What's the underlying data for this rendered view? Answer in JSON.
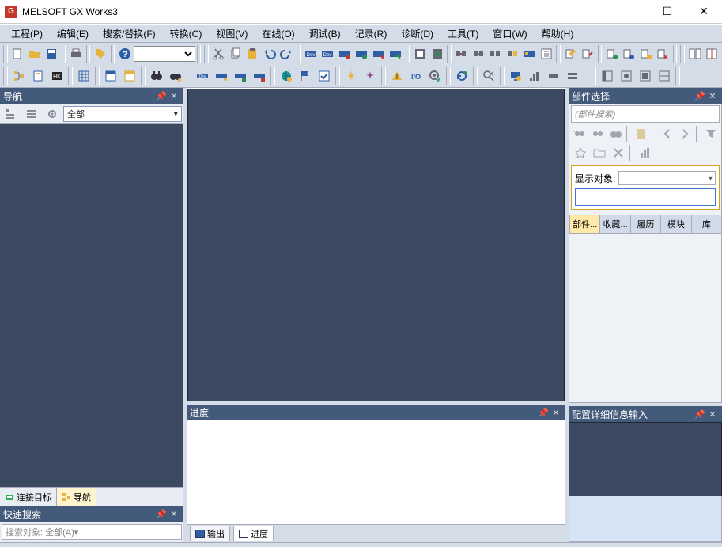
{
  "title": "MELSOFT GX Works3",
  "window": {
    "min": "—",
    "max": "☐",
    "close": "✕"
  },
  "menu": [
    "工程(P)",
    "编辑(E)",
    "搜索/替换(F)",
    "转换(C)",
    "视图(V)",
    "在线(O)",
    "调试(B)",
    "记录(R)",
    "诊断(D)",
    "工具(T)",
    "窗口(W)",
    "帮助(H)"
  ],
  "nav": {
    "title": "导航",
    "filter_label": "全部",
    "tabs": {
      "conn": "连接目标",
      "nav": "导航"
    }
  },
  "quick_search": {
    "title": "快速搜索",
    "placeholder": "搜索对象: 全部(A)▾"
  },
  "progress": {
    "title": "进度",
    "tabs": {
      "output": "输出",
      "progress": "进度"
    }
  },
  "parts": {
    "title": "部件选择",
    "search_placeholder": "(部件搜索)",
    "display_label": "显示对象:",
    "tabs": [
      "部件...",
      "收藏...",
      "履历",
      "模块",
      "库"
    ]
  },
  "config": {
    "title": "配置详细信息输入"
  },
  "pin_glyph": "▾",
  "close_glyph": "✕",
  "dropdown_glyph": "▾"
}
